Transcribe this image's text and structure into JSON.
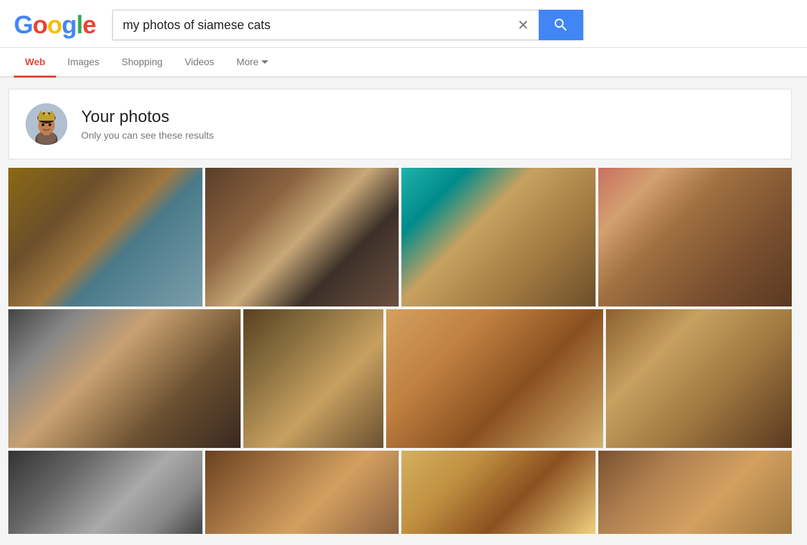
{
  "logo": {
    "letters": [
      {
        "char": "G",
        "color": "#4285F4"
      },
      {
        "char": "o",
        "color": "#EA4335"
      },
      {
        "char": "o",
        "color": "#FBBC05"
      },
      {
        "char": "g",
        "color": "#4285F4"
      },
      {
        "char": "l",
        "color": "#34A853"
      },
      {
        "char": "e",
        "color": "#EA4335"
      }
    ]
  },
  "search": {
    "query": "my photos of siamese cats",
    "placeholder": "Search"
  },
  "nav": {
    "tabs": [
      {
        "label": "Web",
        "active": true
      },
      {
        "label": "Images",
        "active": false
      },
      {
        "label": "Shopping",
        "active": false
      },
      {
        "label": "Videos",
        "active": false
      },
      {
        "label": "More",
        "active": false,
        "has_chevron": true
      }
    ]
  },
  "your_photos": {
    "title": "Your photos",
    "subtitle": "Only you can see these results"
  },
  "photos": {
    "row1": [
      {
        "id": "photo-1",
        "class": "cat-photo-1"
      },
      {
        "id": "photo-2",
        "class": "cat-photo-2"
      },
      {
        "id": "photo-3",
        "class": "cat-photo-3"
      },
      {
        "id": "photo-4",
        "class": "cat-photo-4"
      }
    ],
    "row2": [
      {
        "id": "photo-5",
        "class": "cat-photo-5"
      },
      {
        "id": "photo-6",
        "class": "cat-photo-6"
      },
      {
        "id": "photo-7",
        "class": "cat-photo-7"
      },
      {
        "id": "photo-8",
        "class": "cat-photo-8"
      }
    ],
    "row3": [
      {
        "id": "photo-9",
        "class": "cat-photo-9"
      },
      {
        "id": "photo-10",
        "class": "cat-photo-10"
      },
      {
        "id": "photo-11",
        "class": "cat-photo-11"
      },
      {
        "id": "photo-12",
        "class": "cat-photo-12"
      }
    ]
  }
}
